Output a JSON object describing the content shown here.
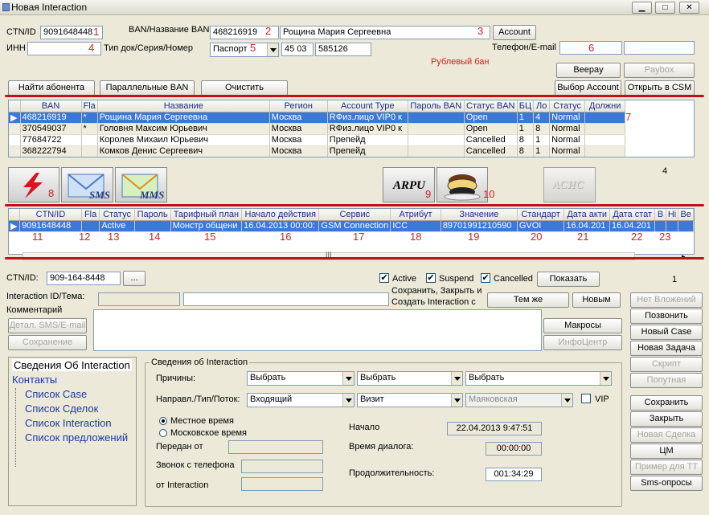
{
  "window": {
    "title": "Новая Interaction"
  },
  "search": {
    "ctn_label": "CTN/ID",
    "ctn_value": "9091648448",
    "ban_label": "BAN/Название BAN",
    "ban_value": "468216919",
    "ban_name_value": "Рощина Мария Сергеевна",
    "account_button": "Account",
    "inn_label": "ИНН",
    "inn_value": "",
    "doc_label": "Тип док/Серия/Номер",
    "doc_type": "Паспорт",
    "doc_series": "45 03",
    "doc_number": "585126",
    "phone_label": "Телефон/E-mail",
    "phone_value": "",
    "email_value": "",
    "ruble_ban": "Рублевый бан",
    "beepay_button": "Beepay",
    "paybox_button": "Paybox",
    "find_button": "Найти абонента",
    "parallel_button": "Параллельные BAN",
    "clear_button": "Очистить",
    "select_account_button": "Выбор Account",
    "open_csm_button": "Открыть в CSM"
  },
  "ban_table": {
    "columns": [
      "BAN",
      "Fla",
      "Название",
      "Регион",
      "Account Type",
      "Пароль BAN",
      "Статус BAN",
      "БЦ",
      "Ло",
      "Статус",
      "Должни"
    ],
    "rows": [
      [
        "468216919",
        "*",
        "Рощина Мария Сергеевна",
        "Москва",
        "RФиз.лицо  VIP0  к",
        "",
        "Open",
        "1",
        "4",
        "Normal",
        ""
      ],
      [
        "370549037",
        "*",
        "Головня Максим Юрьевич",
        "Москва",
        "RФиз.лицо  VIP0  к",
        "",
        "Open",
        "1",
        "8",
        "Normal",
        ""
      ],
      [
        "77684722",
        "",
        "Королев Михаил Юрьевич",
        "Москва",
        "Препейд",
        "",
        "Cancelled",
        "8",
        "1",
        "Normal",
        ""
      ],
      [
        "368222794",
        "",
        "Комков Денис Сергеевич",
        "Москва",
        "Препейд",
        "",
        "Cancelled",
        "8",
        "1",
        "Normal",
        ""
      ]
    ]
  },
  "icon_toolbar": {
    "sms_label": "SMS",
    "mms_label": "MMS",
    "arpu_label": "ARPU",
    "acis_label": "АСИС",
    "count": "4"
  },
  "ctn_table": {
    "columns": [
      "CTN/ID",
      "Fla",
      "Статус",
      "Пароль",
      "Тарифный план",
      "Начало действия",
      "Сервис",
      "Атрибут",
      "Значение",
      "Стандарт",
      "Дата акти",
      "Дата стат",
      "В",
      "Hi",
      "Ве"
    ],
    "rows": [
      [
        "9091648448",
        "",
        "Active",
        "",
        "Монстр общени",
        "16.04.2013 00:00:",
        "GSM Connection",
        "ICC",
        "89701991210590",
        "GVOI",
        "16.04.201",
        "16.04.201",
        "",
        "",
        ""
      ]
    ],
    "scroll_mark": "III"
  },
  "annotations": {
    "n1": "1",
    "n2": "2",
    "n3": "3",
    "n4": "4",
    "n5": "5",
    "n6": "6",
    "n7": "7",
    "n8": "8",
    "n9": "9",
    "n10": "10",
    "n11": "11",
    "n12": "12",
    "n13": "13",
    "n14": "14",
    "n15": "15",
    "n16": "16",
    "n17": "17",
    "n18": "18",
    "n19": "19",
    "n20": "20",
    "n21": "21",
    "n22": "22",
    "n23": "23"
  },
  "interaction": {
    "ctn_label": "CTN/ID:",
    "ctn_value": "909-164-8448",
    "dots_button": "...",
    "filter_active": "Active",
    "filter_suspend": "Suspend",
    "filter_cancelled": "Cancelled",
    "show_button": "Показать",
    "page_count": "1",
    "id_label": "Interaction ID/Тема:",
    "id_value": "",
    "topic_value": "",
    "save_close_text": "Сохранить, Закрыть и Создать Interaction с",
    "same_button": "Тем же",
    "new_button": "Новым",
    "comment_label": "Комментарий",
    "comment_value": "",
    "detail_sms_button": "Детал. SMS/E-mail",
    "save_small_button": "Сохранение",
    "macros_button": "Макросы",
    "info_center_button": "ИнфоЦентр"
  },
  "tree": {
    "items": [
      "Сведения Об Interaction",
      "Контакты",
      "Список Case",
      "Список Сделок",
      "Список Interaction",
      "Список предложений"
    ]
  },
  "details": {
    "group_title": "Сведения об Interaction",
    "reasons_label": "Причины:",
    "reason1": "Выбрать",
    "reason2": "Выбрать",
    "reason3": "Выбрать",
    "direction_label": "Направл./Тип/Поток:",
    "direction": "Входящий",
    "type": "Визит",
    "flow": "Маяковская",
    "vip_label": "VIP",
    "local_time": "Местное время",
    "moscow_time": "Московское время",
    "passed_from_label": "Передан от",
    "call_from_label": "Звонок с телефона",
    "from_interaction_label": "от Interaction",
    "start_label": "Начало",
    "start_value": "22.04.2013 9:47:51",
    "dialog_time_label": "Время диалога:",
    "dialog_time_value": "00:00:00",
    "duration_label": "Продолжительность:",
    "duration_value": "001:34:29"
  },
  "right_panel": {
    "no_attachments": "Нет Вложений",
    "call": "Позвонить",
    "new_case": "Новый Case",
    "new_task": "Новая Задача",
    "script": "Скрипт",
    "follow_up": "Попутная",
    "save": "Сохранить",
    "close": "Закрыть",
    "new_deal": "Новая Сделка",
    "cm": "ЦМ",
    "example_tt": "Пример для ТТ",
    "sms_polls": "Sms-опросы"
  }
}
